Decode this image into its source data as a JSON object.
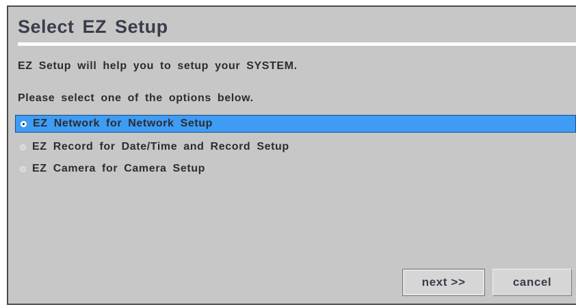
{
  "dialog": {
    "title": "Select EZ Setup",
    "intro_text": "EZ Setup will help you to setup your SYSTEM.",
    "instruction_text": "Please select one of the options below.",
    "options": [
      {
        "label": "EZ Network for Network Setup",
        "selected": true
      },
      {
        "label": "EZ Record for Date/Time and Record Setup",
        "selected": false
      },
      {
        "label": "EZ Camera for Camera Setup",
        "selected": false
      }
    ],
    "next_label": "next >>",
    "cancel_label": "cancel"
  },
  "colors": {
    "background": "#c7c7c7",
    "selection": "#3e9cf4",
    "title_text": "#3a3d4a",
    "body_text": "#2b2b33",
    "title_rule": "#ffffff"
  }
}
